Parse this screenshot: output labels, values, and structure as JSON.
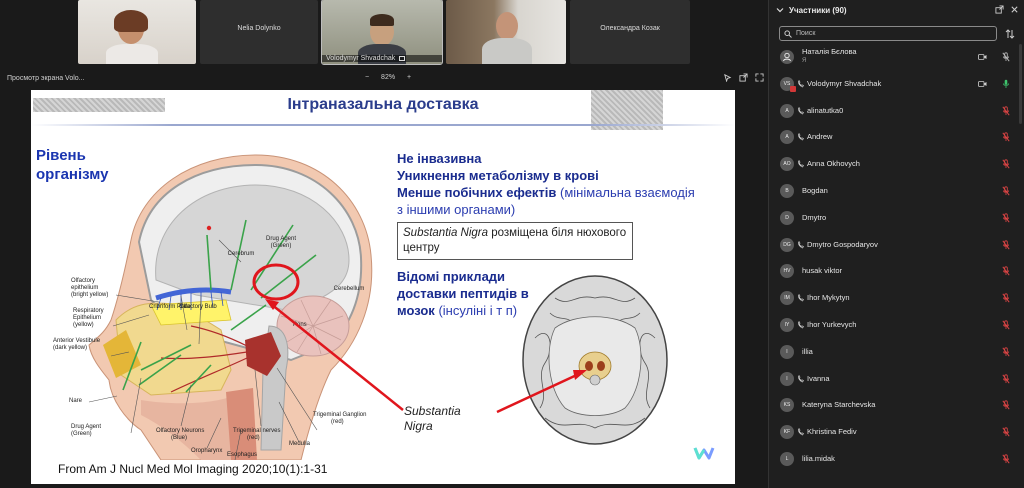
{
  "videos": [
    {
      "name": ""
    },
    {
      "name": "Nelia Dolynko"
    },
    {
      "name": "Volodymyr Shvadchak",
      "badge": "⬛"
    },
    {
      "name": ""
    },
    {
      "name": "Олександра Козак"
    }
  ],
  "share": {
    "title": "Просмотр экрана Volo...",
    "zoom_out": "−",
    "zoom": "82%",
    "zoom_in": "+"
  },
  "slide": {
    "title": "Інтраназальна доставка",
    "level": "Рівень організму",
    "b1": "Не інвазивна",
    "b2": "Уникнення метаболізму в крові",
    "b3": "Менше побічних ефектів",
    "b3_light": "(мінімальна взаємодія з іншими органами)",
    "box_italic": "Substantia Nigra",
    "box_rest": " розміщена біля нюхового центру",
    "ex_bold": "Відомі приклади доставки пептидів в мозок",
    "ex_light": "(інсуліні і т п)",
    "sn_label": "Substantia Nigra",
    "citation": "From  Am J Nucl Med Mol Imaging 2020;10(1):1-31",
    "diagram_labels": {
      "drug_agent_top": "Drug Agent",
      "green": "(Green)",
      "cerebrum": "Cerebrum",
      "cerebellum": "Cerebellum",
      "olf_epi": "Olfactory",
      "olf_epi2": "epithelium",
      "olf_epi3": "(bright yellow)",
      "cribriform": "Cribriform Plate",
      "olf_bulb": "Olfactory Bulb",
      "resp1": "Respiratory",
      "resp2": "Epithelium",
      "resp3": "(yellow)",
      "ant1": "Anterior Vestibule",
      "ant2": "(dark yellow)",
      "pons": "Pons",
      "nare": "Nare",
      "drug_agent_bottom": "Drug Agent",
      "green2": "(Green)",
      "olf_neurons": "Olfactory Neurons",
      "blue": "(Blue)",
      "trig_nerves": "Trigeminal nerves",
      "red": "(red)",
      "trig_ganglion": "Trigeminal Ganglion",
      "red2": "(red)",
      "medulla": "Medulla",
      "oropharynx": "Oropharynx",
      "esophagus": "Esophagus"
    }
  },
  "panel": {
    "title": "Участники (90)",
    "search_placeholder": "Поиск",
    "participants": [
      {
        "initials": "",
        "name": "Наталія Бєлова",
        "sub": "Я",
        "mic": "muted-gray",
        "cam": true,
        "phone": false
      },
      {
        "initials": "VS",
        "name": "Volodymyr Shvadchak",
        "sub": "",
        "mic": "active",
        "cam": true,
        "phone": true,
        "badge": true
      },
      {
        "initials": "A",
        "name": "alinatutka0",
        "sub": "",
        "mic": "muted",
        "cam": false,
        "phone": true
      },
      {
        "initials": "A",
        "name": "Andrew",
        "sub": "",
        "mic": "muted",
        "cam": false,
        "phone": true
      },
      {
        "initials": "AO",
        "name": "Anna Okhovych",
        "sub": "",
        "mic": "muted",
        "cam": false,
        "phone": true
      },
      {
        "initials": "B",
        "name": "Bogdan",
        "sub": "",
        "mic": "muted",
        "cam": false,
        "phone": false
      },
      {
        "initials": "D",
        "name": "Dmytro",
        "sub": "",
        "mic": "muted",
        "cam": false,
        "phone": false
      },
      {
        "initials": "DG",
        "name": "Dmytro Gospodaryov",
        "sub": "",
        "mic": "muted",
        "cam": false,
        "phone": true
      },
      {
        "initials": "HV",
        "name": "husak viktor",
        "sub": "",
        "mic": "muted",
        "cam": false,
        "phone": false
      },
      {
        "initials": "IM",
        "name": "Ihor Mykytyn",
        "sub": "",
        "mic": "muted",
        "cam": false,
        "phone": true
      },
      {
        "initials": "IY",
        "name": "Ihor Yurkevych",
        "sub": "",
        "mic": "muted",
        "cam": false,
        "phone": true
      },
      {
        "initials": "I",
        "name": "illia",
        "sub": "",
        "mic": "muted",
        "cam": false,
        "phone": false
      },
      {
        "initials": "I",
        "name": "Ivanna",
        "sub": "",
        "mic": "muted",
        "cam": false,
        "phone": true
      },
      {
        "initials": "KS",
        "name": "Kateryna Starchevska",
        "sub": "",
        "mic": "muted",
        "cam": false,
        "phone": false
      },
      {
        "initials": "KF",
        "name": "Khristina Fediv",
        "sub": "",
        "mic": "muted",
        "cam": false,
        "phone": true
      },
      {
        "initials": "L",
        "name": "lilia.midak",
        "sub": "",
        "mic": "muted",
        "cam": false,
        "phone": false
      }
    ]
  }
}
